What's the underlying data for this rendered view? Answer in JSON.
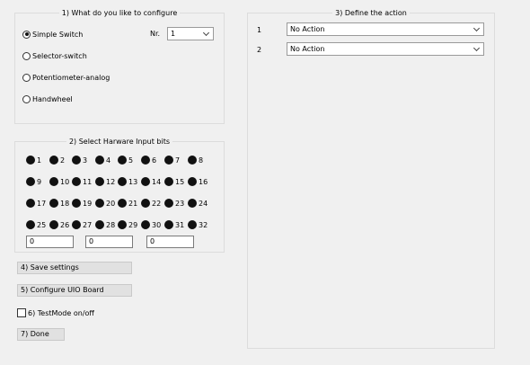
{
  "configure": {
    "title": "1) What do you like to configure",
    "options": [
      {
        "label": "Simple Switch",
        "checked": true
      },
      {
        "label": "Selector-switch",
        "checked": false
      },
      {
        "label": "Potentiometer-analog",
        "checked": false
      },
      {
        "label": "Handwheel",
        "checked": false
      }
    ],
    "nr_label": "Nr.",
    "nr_value": "1"
  },
  "hardware": {
    "title": "2) Select Harware Input bits",
    "bits": [
      "1",
      "2",
      "3",
      "4",
      "5",
      "6",
      "7",
      "8",
      "9",
      "10",
      "11",
      "12",
      "13",
      "14",
      "15",
      "16",
      "17",
      "18",
      "19",
      "20",
      "21",
      "22",
      "23",
      "24",
      "25",
      "26",
      "27",
      "28",
      "29",
      "30",
      "31",
      "32"
    ],
    "inputs": [
      "0",
      "0",
      "0"
    ]
  },
  "actions": {
    "title": "3) Define the action",
    "rows": [
      {
        "index": "1",
        "value": "No Action"
      },
      {
        "index": "2",
        "value": "No Action"
      }
    ]
  },
  "buttons": {
    "save": "4) Save settings",
    "configure_board": "5) Configure UIO Board",
    "testmode": "6) TestMode on/off",
    "done": "7) Done"
  }
}
